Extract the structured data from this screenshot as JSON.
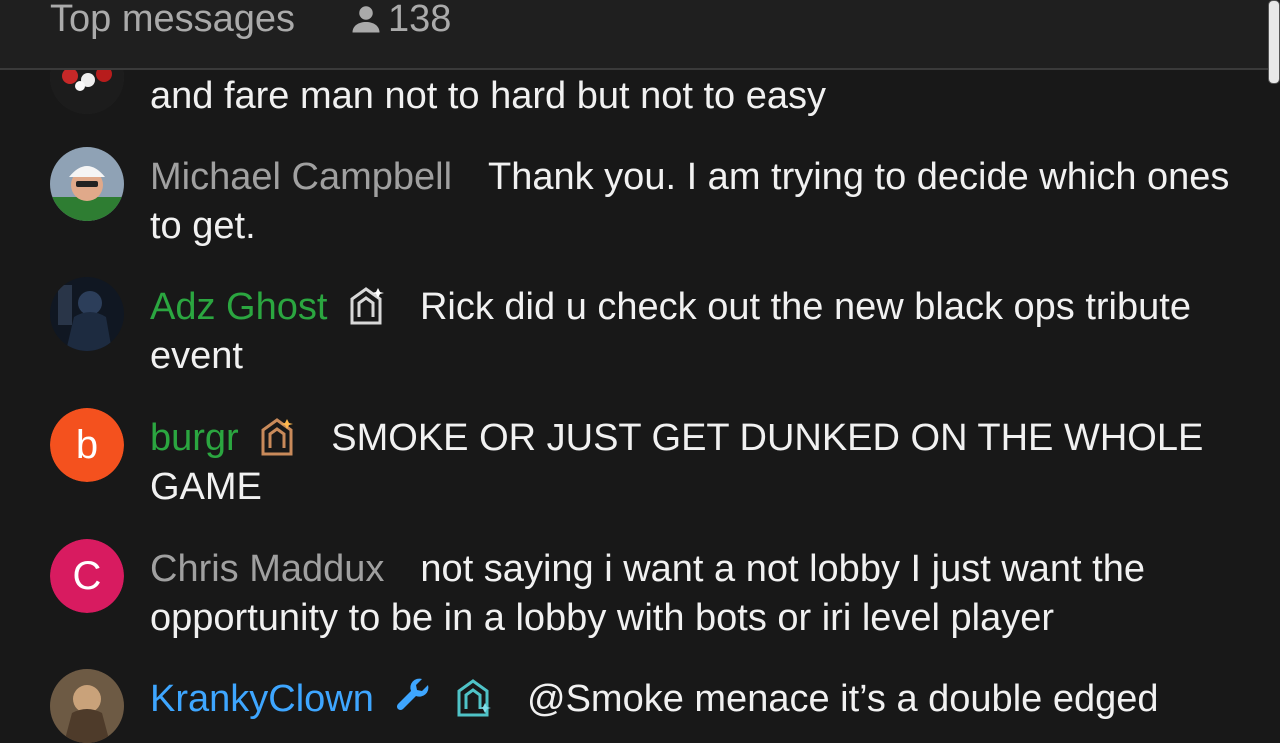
{
  "header": {
    "title": "Top messages",
    "viewer_count": "138"
  },
  "messages": [
    {
      "author": "",
      "text": "and fare man not to hard but not to easy"
    },
    {
      "author": "Michael Campbell",
      "text": "Thank you. I am trying to decide which ones to get."
    },
    {
      "author": "Adz Ghost",
      "text": "Rick did u check out the new black ops tribute event"
    },
    {
      "author": "burgr",
      "avatar_letter": "b",
      "avatar_color": "#f4511e",
      "text": "SMOKE OR JUST GET DUNKED ON THE WHOLE GAME"
    },
    {
      "author": "Chris Maddux",
      "avatar_letter": "C",
      "avatar_color": "#d81b60",
      "text": "not saying i want a not lobby I just want the opportunity to be in a lobby with bots or iri level player"
    },
    {
      "author": "KrankyClown",
      "text": "@Smoke menace it’s a double edged"
    }
  ],
  "colors": {
    "moderator_blue": "#3ea6ff",
    "member_green": "#2ba640",
    "author_gray": "#a0a0a0"
  }
}
